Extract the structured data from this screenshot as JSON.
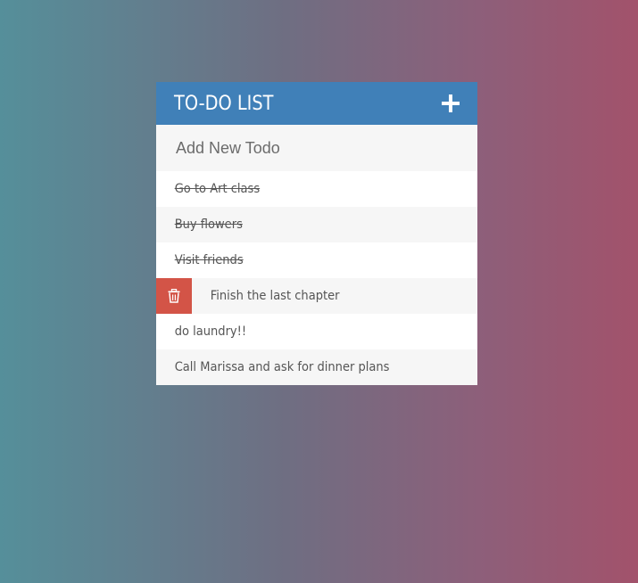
{
  "header": {
    "title": "TO-DO LIST",
    "add_icon": "plus-icon"
  },
  "new_todo": {
    "placeholder": "Add New Todo",
    "value": ""
  },
  "todos": [
    {
      "text": "Go to Art class",
      "completed": true
    },
    {
      "text": "Buy flowers",
      "completed": true
    },
    {
      "text": "Visit friends",
      "completed": true
    },
    {
      "text": "Finish the last chapter",
      "completed": false,
      "delete_visible": true,
      "delete_icon": "trash-icon"
    },
    {
      "text": "do laundry!!",
      "completed": false
    },
    {
      "text": "Call Marissa and ask for dinner plans",
      "completed": false
    }
  ],
  "colors": {
    "header_bg": "#4080b8",
    "delete_bg": "#d35447",
    "row_alt_bg": "#f6f6f6"
  }
}
